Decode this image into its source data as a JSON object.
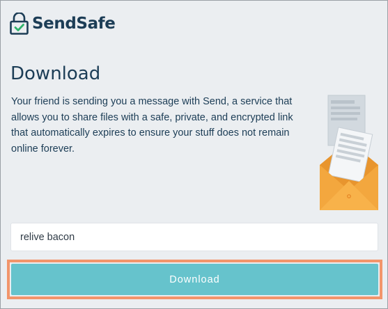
{
  "header": {
    "brand": "SendSafe",
    "logo_icon": "padlock-check-icon"
  },
  "main": {
    "title": "Download",
    "description": "Your friend is sending you a message with Send, a service that allows you to share files with a safe, private, and encrypted link that automatically expires to ensure your stuff does not remain online forever.",
    "illustration_icon": "envelope-documents-illustration",
    "password": {
      "value": "relive bacon",
      "placeholder": ""
    },
    "download_label": "Download"
  },
  "colors": {
    "brand_text": "#1c3d56",
    "logo_green": "#2fb36b",
    "button_bg": "#66c3cc",
    "button_highlight": "#f2956b",
    "page_bg": "#ebeef1",
    "envelope": "#f5a623"
  }
}
